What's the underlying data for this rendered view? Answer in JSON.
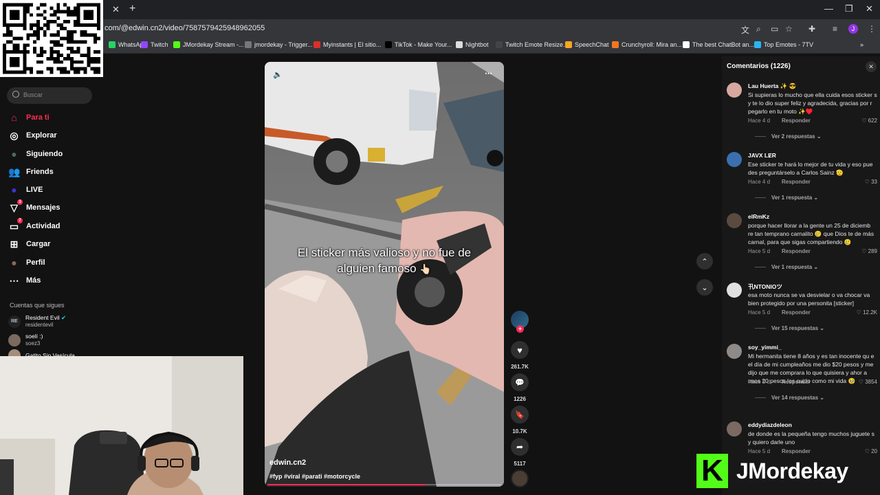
{
  "browser": {
    "url": "com/@edwin.cn2/video/7587579425948962055",
    "bookmarks": [
      {
        "label": "WhatsApp",
        "color": "#25d366"
      },
      {
        "label": "Twitch",
        "color": "#9146ff"
      },
      {
        "label": "JMordekay Stream -...",
        "color": "#53fc18"
      },
      {
        "label": "jmordekay - Trigger...",
        "color": "#777777"
      },
      {
        "label": "Myinstants | El sitio...",
        "color": "#d9302b"
      },
      {
        "label": "TikTok - Make Your...",
        "color": "#000000"
      },
      {
        "label": "Nightbot",
        "color": "#dddddd"
      },
      {
        "label": "Twitch Emote Resize...",
        "color": "#444444"
      },
      {
        "label": "SpeechChat",
        "color": "#f5a623"
      },
      {
        "label": "Crunchyroll: Mira an...",
        "color": "#f47521"
      },
      {
        "label": "The best ChatBot an...",
        "color": "#ffffff"
      },
      {
        "label": "Top Emotes - 7TV",
        "color": "#29b6f6"
      }
    ],
    "profile_initial": "J"
  },
  "sidebar": {
    "search_placeholder": "Buscar",
    "nav": [
      {
        "label": "Para ti",
        "icon": "home-icon"
      },
      {
        "label": "Explorar",
        "icon": "compass-icon"
      },
      {
        "label": "Siguiendo",
        "icon": "following-icon"
      },
      {
        "label": "Friends",
        "icon": "friends-icon"
      },
      {
        "label": "LIVE",
        "icon": "live-icon"
      },
      {
        "label": "Mensajes",
        "icon": "messages-icon",
        "badge": "3"
      },
      {
        "label": "Actividad",
        "icon": "activity-icon",
        "badge": "7"
      },
      {
        "label": "Cargar",
        "icon": "upload-icon"
      },
      {
        "label": "Perfil",
        "icon": "profile-icon"
      },
      {
        "label": "Más",
        "icon": "more-icon"
      }
    ],
    "following_title": "Cuentas que sigues",
    "accounts": [
      {
        "name": "Resident Evil",
        "user": "residentevil",
        "verified": true
      },
      {
        "name": "soelí :)",
        "user": "soez3"
      },
      {
        "name": "Gatito Sin Vesícula",
        "user": ""
      }
    ]
  },
  "video": {
    "caption_line1": "El sticker más valioso y no fue de",
    "caption_line2": "alguien famoso",
    "username": "edwin.cn2",
    "tags": "#fyp #viral #parati #motorcycle",
    "progress": 0.68,
    "likes": "261.7K",
    "comments": "1226",
    "saves": "10.7K",
    "shares": "5117"
  },
  "comments_panel": {
    "title": "Comentarios (1226)",
    "items": [
      {
        "user": "Lau Huerta ✨ 😎",
        "text": "Si supieras lo mucho que ella cuida esos sticker s y te lo dio super feliz y agradecida, gracias por r pegarlo en tu moto ✨♥️",
        "time": "Hace 4 d",
        "reply": "Responder",
        "likes": "622",
        "more": "Ver 2 respuestas"
      },
      {
        "user": "JAVX LɆR",
        "text": "Ese sticker te hará lo mejor de tu vida y eso pue des preguntárselo a Carlos Sainz 🫡",
        "time": "Hace 4 d",
        "reply": "Responder",
        "likes": "33",
        "more": "Ver 1 respuesta"
      },
      {
        "user": "elRmKz",
        "text": "porque hacer llorar a la gente un 25 de diciemb re tan temprano carnalito 🥲 que Dios te de más carnal, para que sigas compartiendo 🥲",
        "time": "Hace 5 d",
        "reply": "Responder",
        "likes": "289",
        "more": "Ver 1 respuesta"
      },
      {
        "user": "卂NTONIOツ",
        "text": "esa moto nunca se va desvielar o va chocar va bien protegido por una personita [sticker]",
        "time": "Hace 5 d",
        "reply": "Responder",
        "likes": "12.2K",
        "more": "Ver 15 respuestas"
      },
      {
        "user": "soy_yimmi_",
        "text": "Mi hermanita tiene 8 años y es tan inocente qu e el día de mi cumpleaños me dio $20 pesos y me dijo que me comprara lo que quisiera y ahor a esos 20 pesos los cuido como mi vida 🥹",
        "time": "Hace 5 d",
        "reply": "Responder",
        "likes": "3854",
        "more": "Ver 14 respuestas"
      },
      {
        "user": "eddydiazdeleon",
        "text": "de donde es la pequeña tengo muchos juguete s y quiero darle uno",
        "time": "Hace 5 d",
        "reply": "Responder",
        "likes": "20",
        "more": ""
      }
    ]
  },
  "overlay": {
    "logo_letter": "K",
    "logo_text": "JMordekay"
  }
}
